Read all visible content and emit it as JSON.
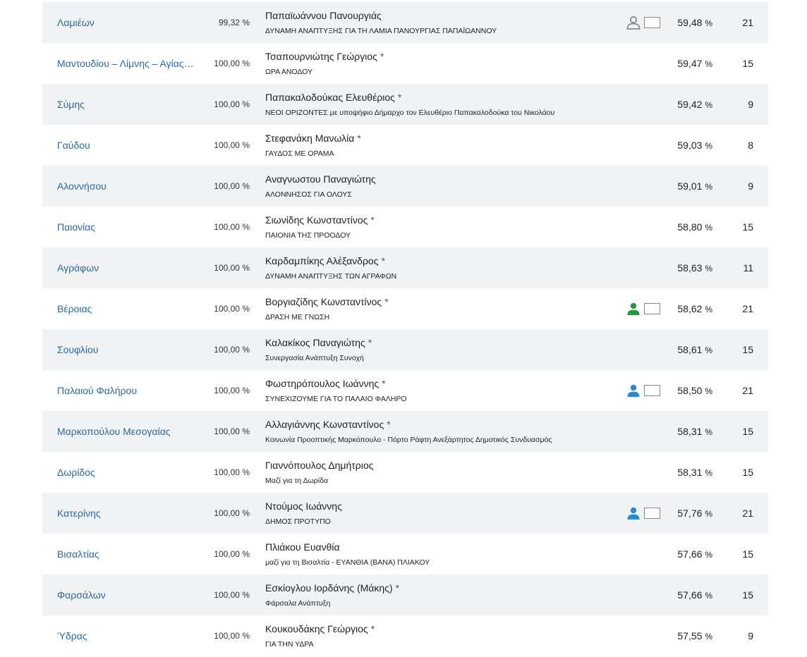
{
  "colors": {
    "link": "#2c69a0",
    "row_alt": "#f1f2f3",
    "icon_gray": "#8a8a8a",
    "icon_green": "#1f9a3d",
    "icon_blue": "#2a8ad4"
  },
  "rows": [
    {
      "municipality": "Λαμιέων",
      "counted": "99,32 %",
      "candidate": "Παπαϊωάννου Πανουργιάς",
      "incumbent": "",
      "party": "ΔΥΝΑΜΗ ΑΝΑΠΤΥΞΗΣ ΓΙΑ ΤΗ ΛΑΜΙΑ ΠΑΝΟΥΡΓΙΑΣ ΠΑΠΑΪΩΑΝΝΟΥ",
      "percent": "59,48",
      "pct_sign": "%",
      "seats": "21",
      "icon": "person-outline-icon",
      "icon_color": "#8a8a8a",
      "has_box": true
    },
    {
      "municipality": "Μαντουδίου – Λίμνης – Αγίας Άννας",
      "counted": "100,00 %",
      "candidate": "Τσαπουρνιώτης Γεώργιος",
      "incumbent": "*",
      "party": "ΩΡΑ ΑΝΟΔΟΥ",
      "percent": "59,47",
      "pct_sign": "%",
      "seats": "15",
      "icon": "",
      "icon_color": "",
      "has_box": false
    },
    {
      "municipality": "Σύμης",
      "counted": "100,00 %",
      "candidate": "Παπακαλοδούκας Ελευθέριος",
      "incumbent": "*",
      "party": "ΝΕΟΙ ΟΡΙΖΟΝΤΕΣ με υποψήφιο Δήμαρχο τον Ελευθέριο Παπακαλοδούκα του Νικολάου",
      "percent": "59,42",
      "pct_sign": "%",
      "seats": "9",
      "icon": "",
      "icon_color": "",
      "has_box": false
    },
    {
      "municipality": "Γαύδου",
      "counted": "100,00 %",
      "candidate": "Στεφανάκη Μανωλία",
      "incumbent": "*",
      "party": "ΓΑΥΔΟΣ ΜΕ ΟΡΑΜΑ",
      "percent": "59,03",
      "pct_sign": "%",
      "seats": "8",
      "icon": "",
      "icon_color": "",
      "has_box": false
    },
    {
      "municipality": "Αλοννήσου",
      "counted": "100,00 %",
      "candidate": "Αναγνωστου Παναγιώτης",
      "incumbent": "",
      "party": "ΑΛΟΝΝΗΣΟΣ ΓΙΑ ΟΛΟΥΣ",
      "percent": "59,01",
      "pct_sign": "%",
      "seats": "9",
      "icon": "",
      "icon_color": "",
      "has_box": false
    },
    {
      "municipality": "Παιονίας",
      "counted": "100,00 %",
      "candidate": "Σιωνίδης Κωνσταντίνος",
      "incumbent": "*",
      "party": "ΠΑΙΟΝΙΑ ΤΗΣ ΠΡΟΟΔΟΥ",
      "percent": "58,80",
      "pct_sign": "%",
      "seats": "15",
      "icon": "",
      "icon_color": "",
      "has_box": false
    },
    {
      "municipality": "Αγράφων",
      "counted": "100,00 %",
      "candidate": "Καρδαμπίκης Αλέξανδρος",
      "incumbent": "*",
      "party": "ΔΥΝΑΜΗ ΑΝΑΠΤΥΞΗΣ ΤΩΝ ΑΓΡΑΦΩΝ",
      "percent": "58,63",
      "pct_sign": "%",
      "seats": "11",
      "icon": "",
      "icon_color": "",
      "has_box": false
    },
    {
      "municipality": "Βέροιας",
      "counted": "100,00 %",
      "candidate": "Βοργιαζίδης Κωνσταντίνος",
      "incumbent": "*",
      "party": "ΔΡΑΣΗ ΜΕ ΓΝΩΣΗ",
      "percent": "58,62",
      "pct_sign": "%",
      "seats": "21",
      "icon": "person-icon",
      "icon_color": "#1f9a3d",
      "has_box": true
    },
    {
      "municipality": "Σουφλίου",
      "counted": "100,00 %",
      "candidate": "Καλακίκος Παναγιώτης",
      "incumbent": "*",
      "party": "Συνεργασία Ανάπτυξη Συνοχή",
      "percent": "58,61",
      "pct_sign": "%",
      "seats": "15",
      "icon": "",
      "icon_color": "",
      "has_box": false
    },
    {
      "municipality": "Παλαιού Φαλήρου",
      "counted": "100,00 %",
      "candidate": "Φωστηρόπουλος Ιωάννης",
      "incumbent": "*",
      "party": "ΣΥΝΕΧΙΖΟΥΜΕ ΓΙΑ ΤΟ ΠΑΛΑΙΟ ΦΑΛΗΡΟ",
      "percent": "58,50",
      "pct_sign": "%",
      "seats": "21",
      "icon": "person-icon",
      "icon_color": "#2a8ad4",
      "has_box": true
    },
    {
      "municipality": "Μαρκοπούλου Μεσογαίας",
      "counted": "100,00 %",
      "candidate": "Αλλαγιάννης Κωνσταντίνος",
      "incumbent": "*",
      "party": "Κοινωνία Προοπτικής Μαρκόπουλο - Πόρτο Ράφτη Ανεξάρτητος Δημοτικός Συνδυασμός",
      "percent": "58,31",
      "pct_sign": "%",
      "seats": "15",
      "icon": "",
      "icon_color": "",
      "has_box": false
    },
    {
      "municipality": "Δωρίδος",
      "counted": "100,00 %",
      "candidate": "Γιαννόπουλος Δημήτριος",
      "incumbent": "",
      "party": "Μαζί για τη Δωρίδα",
      "percent": "58,31",
      "pct_sign": "%",
      "seats": "15",
      "icon": "",
      "icon_color": "",
      "has_box": false
    },
    {
      "municipality": "Κατερίνης",
      "counted": "100,00 %",
      "candidate": "Ντούμος Ιωάννης",
      "incumbent": "",
      "party": "ΔΗΜΟΣ ΠΡΟΤΥΠΟ",
      "percent": "57,76",
      "pct_sign": "%",
      "seats": "21",
      "icon": "person-icon",
      "icon_color": "#2a8ad4",
      "has_box": true
    },
    {
      "municipality": "Βισαλτίας",
      "counted": "100,00 %",
      "candidate": "Πλιάκου Ευανθία",
      "incumbent": "",
      "party": "μαζί για τη Βισαλτία - ΕΥΑΝΘΙΑ (ΒΑΝΑ) ΠΛΙΑΚΟΥ",
      "percent": "57,66",
      "pct_sign": "%",
      "seats": "15",
      "icon": "",
      "icon_color": "",
      "has_box": false
    },
    {
      "municipality": "Φαρσάλων",
      "counted": "100,00 %",
      "candidate": "Εσκίογλου Ιορδάνης (Μάκης)",
      "incumbent": "*",
      "party": "Φάρσαλα Ανάπτυξη",
      "percent": "57,66",
      "pct_sign": "%",
      "seats": "15",
      "icon": "",
      "icon_color": "",
      "has_box": false
    },
    {
      "municipality": "Ύδρας",
      "counted": "100,00 %",
      "candidate": "Κουκουδάκης Γεώργιος",
      "incumbent": "*",
      "party": "ΓΙΑ ΤΗΝ ΥΔΡΑ",
      "percent": "57,55",
      "pct_sign": "%",
      "seats": "9",
      "icon": "",
      "icon_color": "",
      "has_box": false
    }
  ]
}
